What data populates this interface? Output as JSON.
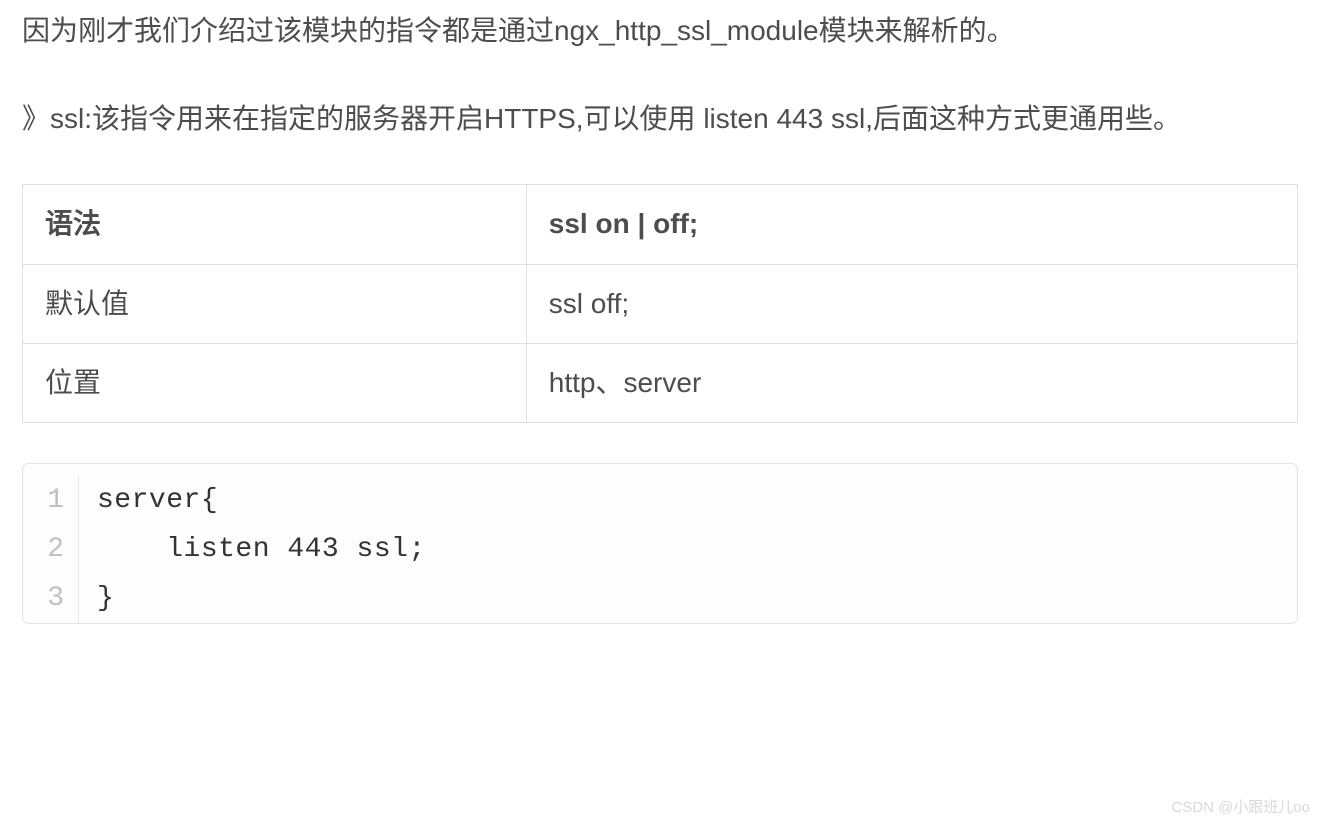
{
  "paragraphs": {
    "p1": "因为刚才我们介绍过该模块的指令都是通过ngx_http_ssl_module模块来解析的。",
    "p2": "》ssl:该指令用来在指定的服务器开启HTTPS,可以使用 listen 443 ssl,后面这种方式更通用些。"
  },
  "table": {
    "header": {
      "col1": "语法",
      "col2": "ssl on | off;"
    },
    "rows": [
      {
        "col1": "默认值",
        "col2": "ssl off;"
      },
      {
        "col1": "位置",
        "col2": "http、server"
      }
    ]
  },
  "code": {
    "lines": [
      {
        "num": "1",
        "text": "server{"
      },
      {
        "num": "2",
        "text": "    listen 443 ssl;"
      },
      {
        "num": "3",
        "text": "}"
      }
    ]
  },
  "watermark": "CSDN @小跟班儿oo"
}
